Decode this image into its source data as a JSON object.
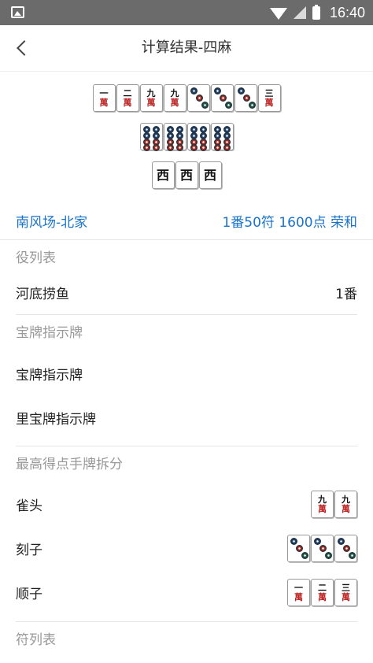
{
  "status": {
    "time": "16:40"
  },
  "header": {
    "title": "计算结果-四麻"
  },
  "hand": {
    "row1": [
      {
        "kind": "man",
        "num": "一"
      },
      {
        "kind": "man",
        "num": "二"
      },
      {
        "kind": "man",
        "num": "九"
      },
      {
        "kind": "man",
        "num": "九"
      },
      {
        "kind": "pin3"
      },
      {
        "kind": "pin3"
      },
      {
        "kind": "pin3"
      },
      {
        "kind": "man",
        "num": "三"
      }
    ],
    "row2_count": 4,
    "row3": [
      "西",
      "西",
      "西"
    ]
  },
  "result": {
    "round": "南风场-北家",
    "score": "1番50符 1600点 荣和"
  },
  "yaku": {
    "title": "役列表",
    "items": [
      {
        "name": "河底捞鱼",
        "han": "1番"
      }
    ]
  },
  "dora": {
    "title": "宝牌指示牌",
    "dora_label": "宝牌指示牌",
    "ura_label": "里宝牌指示牌"
  },
  "split": {
    "title": "最高得点手牌拆分",
    "pair_label": "雀头",
    "pair": [
      "九",
      "九"
    ],
    "triplet_label": "刻子",
    "sequence_label": "顺子",
    "sequence": [
      "一",
      "二",
      "三"
    ]
  },
  "fu": {
    "title": "符列表"
  },
  "tile_suffix": "萬"
}
